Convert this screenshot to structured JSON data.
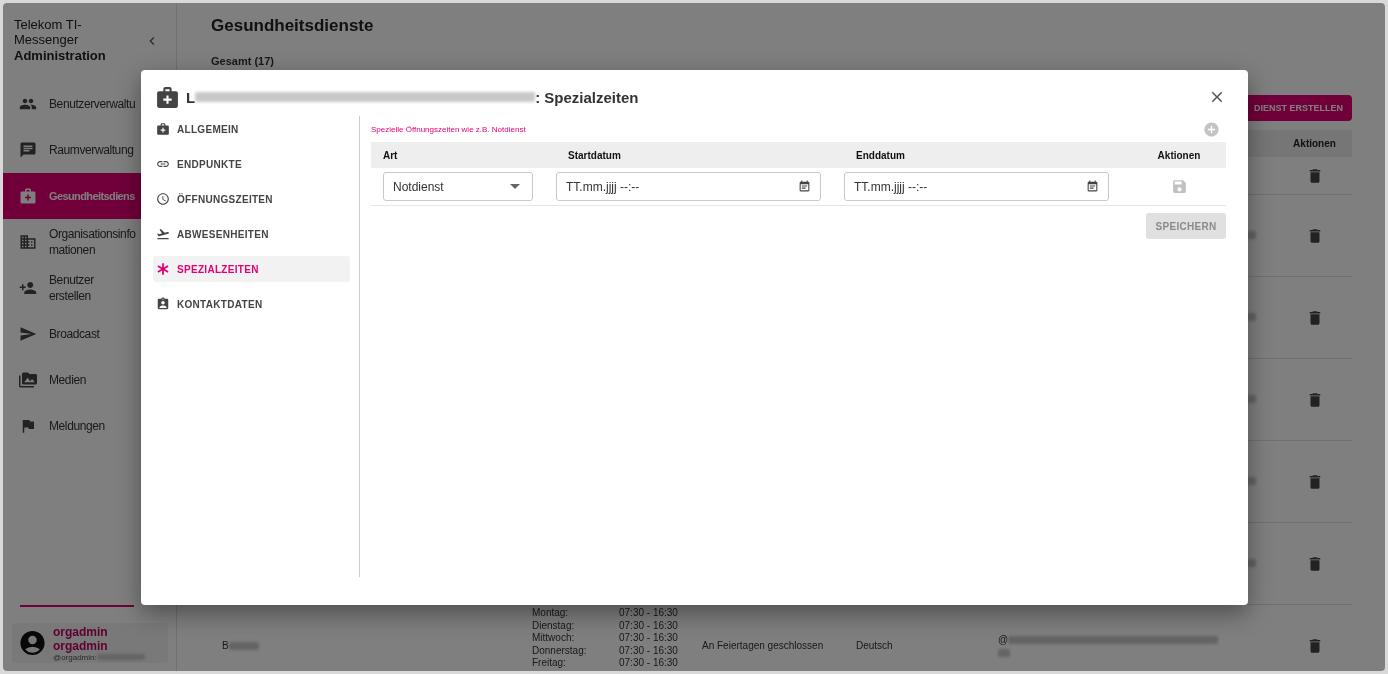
{
  "sidebar": {
    "brand": "Telekom TI-Messenger",
    "subtitle": "Administration",
    "items": [
      {
        "label": "Benutzerverwaltu",
        "selected": false
      },
      {
        "label": "Raumverwaltung",
        "selected": false
      },
      {
        "label": "Gesundheitsdiens",
        "selected": true
      },
      {
        "label": "Organisationsinfo\nmationen",
        "selected": false
      },
      {
        "label": "Benutzer erstellen",
        "selected": false
      },
      {
        "label": "Broadcast",
        "selected": false
      },
      {
        "label": "Medien",
        "selected": false
      },
      {
        "label": "Meldungen",
        "selected": false
      }
    ],
    "user": {
      "name": "orgadmin orgadmin",
      "handle_prefix": "@orgadmin:"
    }
  },
  "page": {
    "title": "Gesundheitsdienste",
    "count": "Gesamt (17)",
    "create_button": "DIENST ERSTELLEN",
    "actions_header": "Aktionen",
    "rows": [
      {
        "email_blurred": false
      },
      {
        "email_blurred": true
      },
      {
        "email_blurred": true
      },
      {
        "email_blurred": true
      },
      {
        "email_blurred": true
      },
      {
        "email_blurred": true
      },
      {
        "email_blurred": true,
        "name_start": "B",
        "schedule": [
          {
            "day": "Montag:",
            "time": "07:30 - 16:30"
          },
          {
            "day": "Dienstag:",
            "time": "07:30 - 16:30"
          },
          {
            "day": "Mittwoch:",
            "time": "07:30 - 16:30"
          },
          {
            "day": "Donnerstag:",
            "time": "07:30 - 16:30"
          },
          {
            "day": "Freitag:",
            "time": "07:30 - 16:30"
          }
        ],
        "note": "An Feiertagen geschlossen",
        "language": "Deutsch",
        "email_start": "@"
      }
    ]
  },
  "dialog": {
    "title_start": "L",
    "title_end": ": Spezialzeiten",
    "nav": [
      {
        "label": "ALLGEMEIN",
        "selected": false
      },
      {
        "label": "ENDPUNKTE",
        "selected": false
      },
      {
        "label": "ÖFFNUNGSZEITEN",
        "selected": false
      },
      {
        "label": "ABWESENHEITEN",
        "selected": false
      },
      {
        "label": "SPEZIALZEITEN",
        "selected": true
      },
      {
        "label": "KONTAKTDATEN",
        "selected": false
      }
    ],
    "hint": "Spezielle Öffnungszeiten wie z.B. Notdienst",
    "columns": [
      "Art",
      "Startdatum",
      "Enddatum",
      "Aktionen"
    ],
    "rows": [
      {
        "type": "Notdienst",
        "start_placeholder": "TT.mm.jjjj --:--",
        "end_placeholder": "TT.mm.jjjj --:--"
      }
    ],
    "save_button": {
      "label": "SPEICHERN",
      "disabled": true
    }
  }
}
